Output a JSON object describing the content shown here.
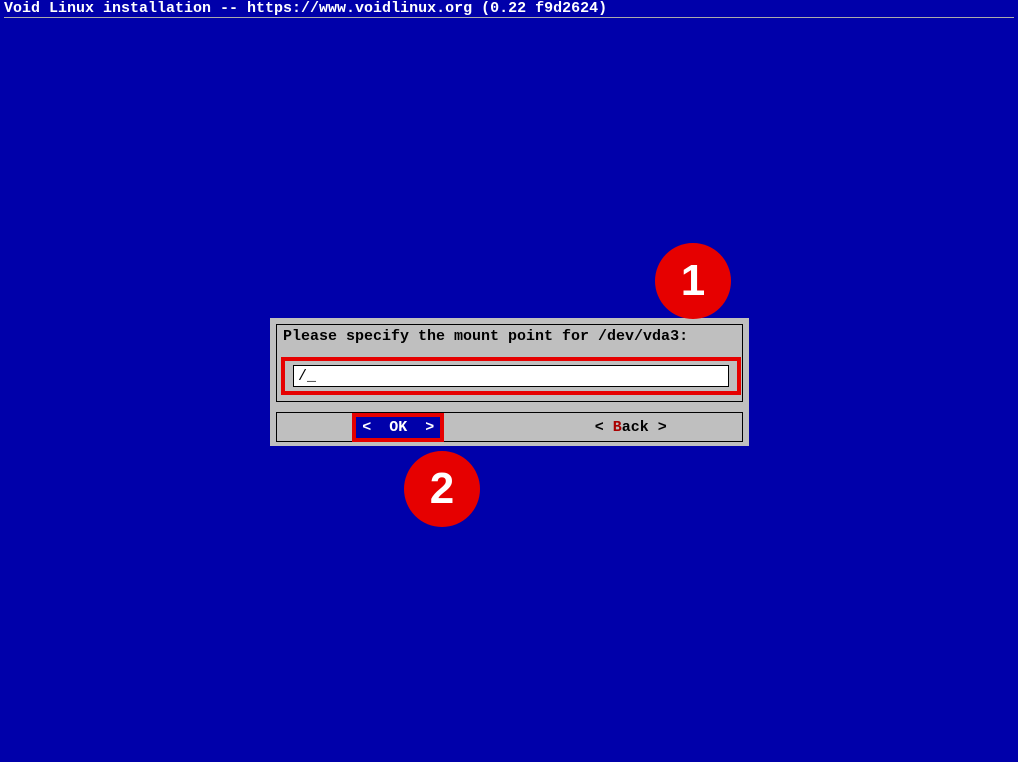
{
  "header": {
    "title": "Void Linux installation -- https://www.voidlinux.org (0.22 f9d2624)"
  },
  "dialog": {
    "prompt": "Please specify the mount point for /dev/vda3:",
    "input_value": "/_",
    "ok_label": "<  OK  >",
    "back_label_pre": "< ",
    "back_hotkey": "B",
    "back_label_post": "ack >"
  },
  "annotations": {
    "marker1": "1",
    "marker2": "2"
  }
}
